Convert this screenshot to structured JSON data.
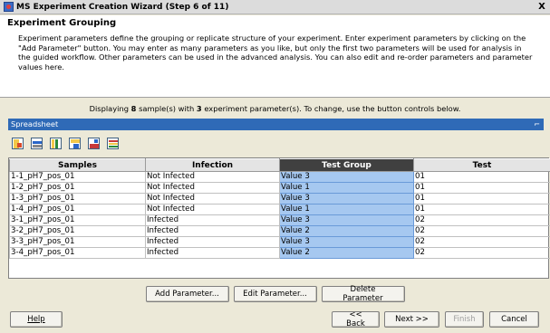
{
  "window": {
    "title": "MS Experiment Creation Wizard (Step 6 of 11)",
    "close_glyph": "X"
  },
  "header": {
    "title": "Experiment Grouping",
    "description": "Experiment parameters define the grouping or replicate structure of your experiment. Enter experiment parameters by clicking on the \"Add Parameter\" button. You may enter as many parameters as you like, but only the first two parameters will be used for analysis in the guided workflow. Other parameters can be used in the advanced analysis. You can also edit and re-order parameters and parameter values here."
  },
  "display_line": {
    "prefix": "Displaying ",
    "sample_count": "8",
    "middle": " sample(s) with ",
    "param_count": "3",
    "suffix": " experiment parameter(s). To change, use the button controls below."
  },
  "spreadsheet": {
    "title": "Spreadsheet",
    "pin_glyph": "⌐",
    "toolbar_icons": [
      "import-icon",
      "export-icon",
      "column-icon",
      "sort-icon",
      "chart-icon",
      "order-icon"
    ],
    "columns": [
      "Samples",
      "Infection",
      "Test Group",
      "Test"
    ],
    "selected_column": "Test Group",
    "rows": [
      [
        "1-1_pH7_pos_01",
        "Not Infected",
        "Value 3",
        "01"
      ],
      [
        "1-2_pH7_pos_01",
        "Not Infected",
        "Value 1",
        "01"
      ],
      [
        "1-3_pH7_pos_01",
        "Not Infected",
        "Value 3",
        "01"
      ],
      [
        "1-4_pH7_pos_01",
        "Not Infected",
        "Value 1",
        "01"
      ],
      [
        "3-1_pH7_pos_01",
        "Infected",
        "Value 3",
        "02"
      ],
      [
        "3-2_pH7_pos_01",
        "Infected",
        "Value 2",
        "02"
      ],
      [
        "3-3_pH7_pos_01",
        "Infected",
        "Value 3",
        "02"
      ],
      [
        "3-4_pH7_pos_01",
        "Infected",
        "Value 2",
        "02"
      ]
    ]
  },
  "param_buttons": {
    "add": "Add Parameter...",
    "edit": "Edit Parameter...",
    "delete": "Delete Parameter"
  },
  "nav": {
    "help": "Help",
    "back": "<< Back",
    "next": "Next >>",
    "finish": "Finish",
    "cancel": "Cancel"
  }
}
